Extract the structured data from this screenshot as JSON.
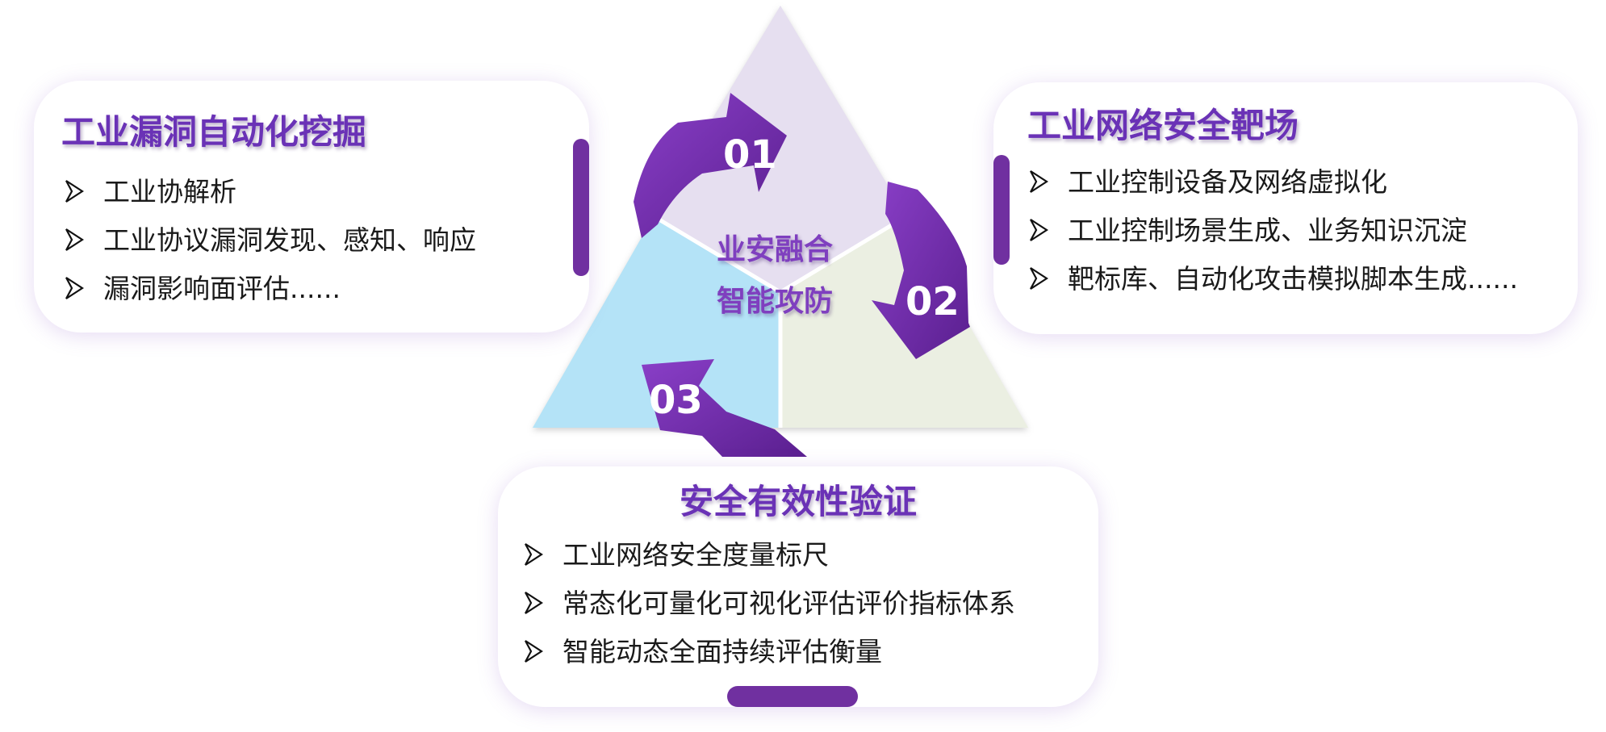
{
  "center": {
    "line1": "业安融合",
    "line2": "智能攻防"
  },
  "steps": [
    "01",
    "02",
    "03"
  ],
  "cards": {
    "left": {
      "title": "工业漏洞自动化挖掘",
      "items": [
        "工业协解析",
        "工业协议漏洞发现、感知、响应",
        "漏洞影响面评估......"
      ]
    },
    "right": {
      "title": "工业网络安全靶场",
      "items": [
        "工业控制设备及网络虚拟化",
        "工业控制场景生成、业务知识沉淀",
        "靶标库、自动化攻击模拟脚本生成......"
      ]
    },
    "bottom": {
      "title": "安全有效性验证",
      "items": [
        "工业网络安全度量标尺",
        "常态化可量化可视化评估评价指标体系",
        "智能动态全面持续评估衡量"
      ]
    }
  },
  "colors": {
    "accent": "#7030a0",
    "title": "#6a32b6",
    "segment_top": "#e6dff0",
    "segment_left": "#b4e3f7",
    "segment_right": "#ebefe2"
  },
  "icons": {
    "bullet": "arrowhead-bullet-icon",
    "cycle_arrow": "curved-arrow-icon"
  }
}
